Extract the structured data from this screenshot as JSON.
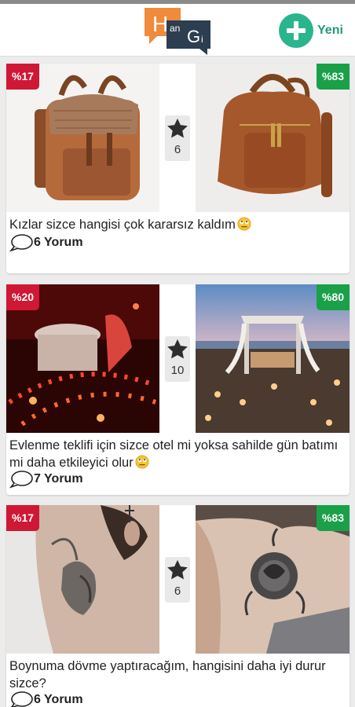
{
  "app": {
    "logo_letters": [
      "H",
      "an",
      "G",
      "i"
    ],
    "new_label": "Yeni",
    "accent": "#2bb58e"
  },
  "posts": [
    {
      "left_percent": "%17",
      "right_percent": "%83",
      "stars": "6",
      "title": "Kızlar sizce hangisi çok kararsız kaldım",
      "comments": "6 Yorum"
    },
    {
      "left_percent": "%20",
      "right_percent": "%80",
      "stars": "10",
      "title": "Evlenme teklifi için sizce otel mi yoksa sahilde gün batımı mi daha etkileyici olur",
      "comments": "7 Yorum"
    },
    {
      "left_percent": "%17",
      "right_percent": "%83",
      "stars": "6",
      "title": "Boynuma dövme yaptıracağım, hangisini daha iyi durur sizce?",
      "comments": "6 Yorum"
    }
  ]
}
